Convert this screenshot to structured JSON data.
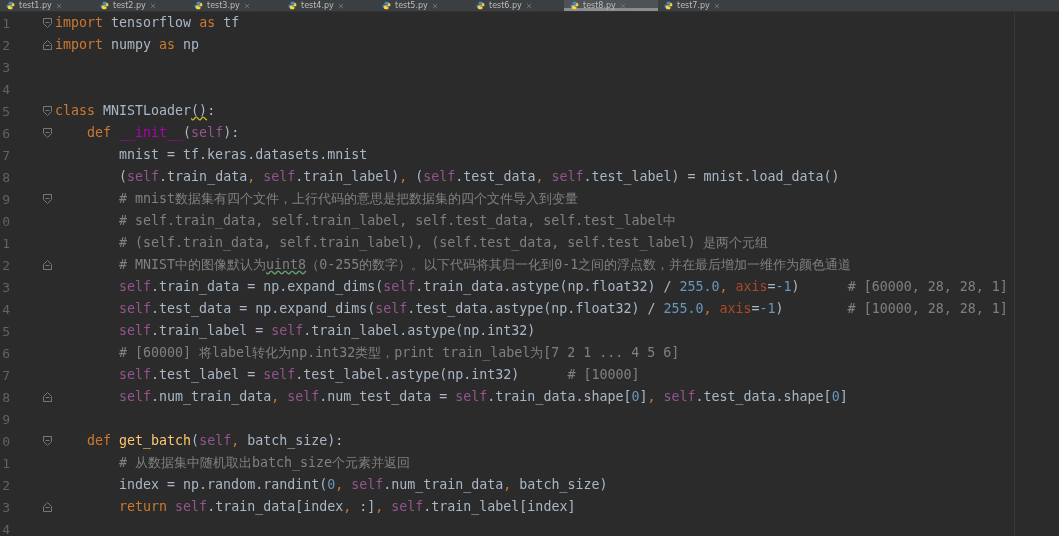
{
  "tabs": [
    {
      "label": "test1.py",
      "selected": false
    },
    {
      "label": "test2.py",
      "selected": false
    },
    {
      "label": "test3.py",
      "selected": false
    },
    {
      "label": "test4.py",
      "selected": false
    },
    {
      "label": "test5.py",
      "selected": false
    },
    {
      "label": "test6.py",
      "selected": false
    },
    {
      "label": "test8.py",
      "selected": true
    },
    {
      "label": "test7.py",
      "selected": false
    }
  ],
  "lines": [
    {
      "number": "1",
      "fold": {
        "kind": "open"
      },
      "tokens": [
        {
          "kind": "kw",
          "text": "import"
        },
        {
          "kind": "plain",
          "text": " tensorflow "
        },
        {
          "kind": "kw",
          "text": "as"
        },
        {
          "kind": "plain",
          "text": " tf"
        }
      ]
    },
    {
      "number": "2",
      "fold": {
        "kind": "close"
      },
      "tokens": [
        {
          "kind": "kw",
          "text": "import"
        },
        {
          "kind": "plain",
          "text": " numpy "
        },
        {
          "kind": "kw",
          "text": "as"
        },
        {
          "kind": "plain",
          "text": " np"
        }
      ]
    },
    {
      "number": "3"
    },
    {
      "number": "4"
    },
    {
      "number": "5",
      "fold": {
        "kind": "open"
      },
      "tokens": [
        {
          "kind": "kw",
          "text": "class"
        },
        {
          "kind": "plain",
          "text": " MNISTLoader"
        },
        {
          "kind": "warn",
          "text": "()"
        },
        {
          "kind": "plain",
          "text": ":"
        }
      ]
    },
    {
      "number": "6",
      "fold": {
        "kind": "open"
      },
      "tokens": [
        {
          "kind": "kw",
          "text": "    def "
        },
        {
          "kind": "magic",
          "text": "__init__"
        },
        {
          "kind": "plain",
          "text": "("
        },
        {
          "kind": "self",
          "text": "self"
        },
        {
          "kind": "plain",
          "text": "):"
        }
      ]
    },
    {
      "number": "7",
      "tokens": [
        {
          "kind": "plain",
          "text": "        mnist = tf.keras.datasets.mnist"
        }
      ]
    },
    {
      "number": "8",
      "tokens": [
        {
          "kind": "plain",
          "text": "        ("
        },
        {
          "kind": "self",
          "text": "self"
        },
        {
          "kind": "plain",
          "text": ".train_data"
        },
        {
          "kind": "punct",
          "text": ", "
        },
        {
          "kind": "self",
          "text": "self"
        },
        {
          "kind": "plain",
          "text": ".train_label)"
        },
        {
          "kind": "punct",
          "text": ", "
        },
        {
          "kind": "plain",
          "text": "("
        },
        {
          "kind": "self",
          "text": "self"
        },
        {
          "kind": "plain",
          "text": ".test_data"
        },
        {
          "kind": "punct",
          "text": ", "
        },
        {
          "kind": "self",
          "text": "self"
        },
        {
          "kind": "plain",
          "text": ".test_label) = mnist.load_data()"
        }
      ]
    },
    {
      "number": "9",
      "fold": {
        "kind": "open"
      },
      "tokens": [
        {
          "kind": "comment",
          "text": "        # mnist数据集有四个文件，上行代码的意思是把数据集的四个文件导入到变量"
        }
      ]
    },
    {
      "number": "0",
      "tokens": [
        {
          "kind": "comment",
          "text": "        # self.train_data, self.train_label, self.test_data, self.test_label中"
        }
      ]
    },
    {
      "number": "1",
      "tokens": [
        {
          "kind": "comment",
          "text": "        # (self.train_data, self.train_label), (self.test_data, self.test_label) 是两个元组"
        }
      ]
    },
    {
      "number": "2",
      "fold": {
        "kind": "close"
      },
      "tokens": [
        {
          "kind": "comment",
          "text": "        # MNIST中的图像默认为"
        },
        {
          "kind": "typo",
          "text": "uint8"
        },
        {
          "kind": "comment",
          "text": "（0-255的数字）。以下代码将其归一化到0-1之间的浮点数，并在最后增加一维作为颜色通道"
        }
      ]
    },
    {
      "number": "3",
      "tokens": [
        {
          "kind": "self",
          "text": "        self"
        },
        {
          "kind": "plain",
          "text": ".train_data = np.expand_dims("
        },
        {
          "kind": "self",
          "text": "self"
        },
        {
          "kind": "plain",
          "text": ".train_data.astype(np.float32) / "
        },
        {
          "kind": "num",
          "text": "255.0"
        },
        {
          "kind": "punct",
          "text": ", "
        },
        {
          "kind": "param",
          "text": "axis"
        },
        {
          "kind": "plain",
          "text": "="
        },
        {
          "kind": "num",
          "text": "-1"
        },
        {
          "kind": "plain",
          "text": ")"
        },
        {
          "kind": "comment",
          "text": "      # [60000, 28, 28, 1]"
        }
      ]
    },
    {
      "number": "4",
      "tokens": [
        {
          "kind": "self",
          "text": "        self"
        },
        {
          "kind": "plain",
          "text": ".test_data = np.expand_dims("
        },
        {
          "kind": "self",
          "text": "self"
        },
        {
          "kind": "plain",
          "text": ".test_data.astype(np.float32) / "
        },
        {
          "kind": "num",
          "text": "255.0"
        },
        {
          "kind": "punct",
          "text": ", "
        },
        {
          "kind": "param",
          "text": "axis"
        },
        {
          "kind": "plain",
          "text": "="
        },
        {
          "kind": "num",
          "text": "-1"
        },
        {
          "kind": "plain",
          "text": ")"
        },
        {
          "kind": "comment",
          "text": "        # [10000, 28, 28, 1]"
        }
      ]
    },
    {
      "number": "5",
      "tokens": [
        {
          "kind": "self",
          "text": "        self"
        },
        {
          "kind": "plain",
          "text": ".train_label = "
        },
        {
          "kind": "self",
          "text": "self"
        },
        {
          "kind": "plain",
          "text": ".train_label.astype(np.int32)"
        }
      ]
    },
    {
      "number": "6",
      "tokens": [
        {
          "kind": "comment",
          "text": "        # [60000] 将label转化为np.int32类型，print train_label为[7 2 1 ... 4 5 6]"
        }
      ]
    },
    {
      "number": "7",
      "tokens": [
        {
          "kind": "self",
          "text": "        self"
        },
        {
          "kind": "plain",
          "text": ".test_label = "
        },
        {
          "kind": "self",
          "text": "self"
        },
        {
          "kind": "plain",
          "text": ".test_label.astype(np.int32)"
        },
        {
          "kind": "comment",
          "text": "      # [10000]"
        }
      ]
    },
    {
      "number": "8",
      "fold": {
        "kind": "close"
      },
      "tokens": [
        {
          "kind": "self",
          "text": "        self"
        },
        {
          "kind": "plain",
          "text": ".num_train_data"
        },
        {
          "kind": "punct",
          "text": ", "
        },
        {
          "kind": "self",
          "text": "self"
        },
        {
          "kind": "plain",
          "text": ".num_test_data = "
        },
        {
          "kind": "self",
          "text": "self"
        },
        {
          "kind": "plain",
          "text": ".train_data.shape["
        },
        {
          "kind": "num",
          "text": "0"
        },
        {
          "kind": "plain",
          "text": "]"
        },
        {
          "kind": "punct",
          "text": ", "
        },
        {
          "kind": "self",
          "text": "self"
        },
        {
          "kind": "plain",
          "text": ".test_data.shape["
        },
        {
          "kind": "num",
          "text": "0"
        },
        {
          "kind": "plain",
          "text": "]"
        }
      ]
    },
    {
      "number": "9"
    },
    {
      "number": "0",
      "fold": {
        "kind": "open"
      },
      "tokens": [
        {
          "kind": "kw",
          "text": "    def "
        },
        {
          "kind": "fn",
          "text": "get_batch"
        },
        {
          "kind": "plain",
          "text": "("
        },
        {
          "kind": "self",
          "text": "self"
        },
        {
          "kind": "punct",
          "text": ", "
        },
        {
          "kind": "plain",
          "text": "batch_size):"
        }
      ]
    },
    {
      "number": "1",
      "tokens": [
        {
          "kind": "comment",
          "text": "        # 从数据集中随机取出batch_size个元素并返回"
        }
      ]
    },
    {
      "number": "2",
      "tokens": [
        {
          "kind": "plain",
          "text": "        index = np.random.randint("
        },
        {
          "kind": "num",
          "text": "0"
        },
        {
          "kind": "punct",
          "text": ", "
        },
        {
          "kind": "self",
          "text": "self"
        },
        {
          "kind": "plain",
          "text": ".num_train_data"
        },
        {
          "kind": "punct",
          "text": ", "
        },
        {
          "kind": "plain",
          "text": "batch_size)"
        }
      ]
    },
    {
      "number": "3",
      "fold": {
        "kind": "close"
      },
      "tokens": [
        {
          "kind": "kw",
          "text": "        return "
        },
        {
          "kind": "self",
          "text": "self"
        },
        {
          "kind": "plain",
          "text": ".train_data[index"
        },
        {
          "kind": "punct",
          "text": ", "
        },
        {
          "kind": "plain",
          "text": ":]"
        },
        {
          "kind": "punct",
          "text": ", "
        },
        {
          "kind": "self",
          "text": "self"
        },
        {
          "kind": "plain",
          "text": ".train_label[index]"
        }
      ]
    },
    {
      "number": "4"
    }
  ]
}
